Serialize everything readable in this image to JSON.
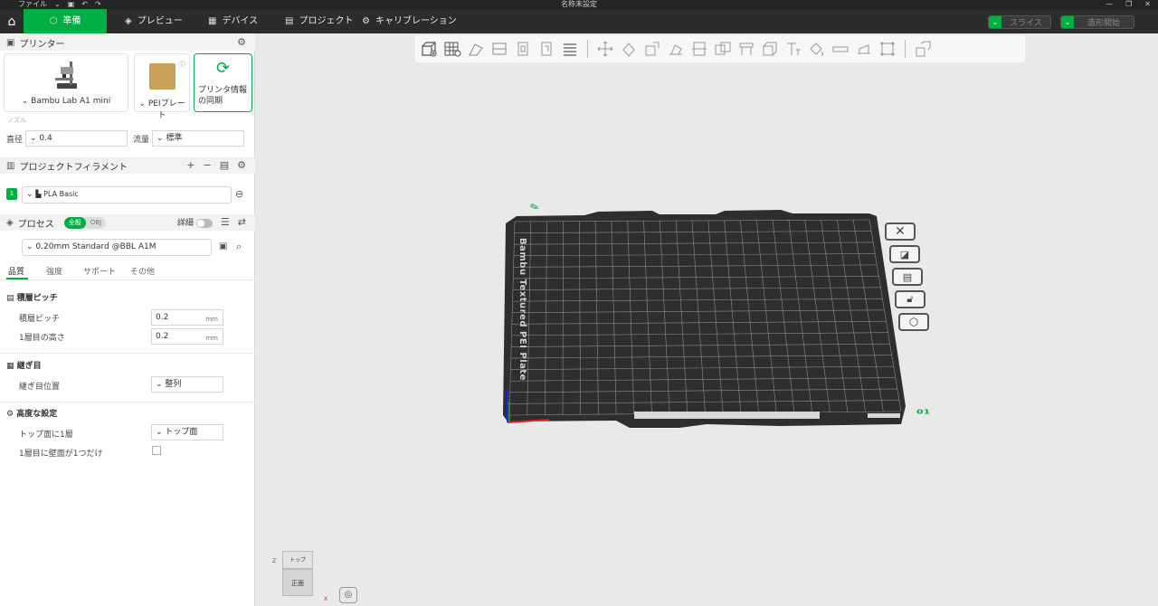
{
  "titlebar": {
    "file_menu": "ファイル",
    "title": "名称未設定"
  },
  "tabs": [
    {
      "label": "準備",
      "icon": "cube-icon"
    },
    {
      "label": "プレビュー",
      "icon": "layers-icon"
    },
    {
      "label": "デバイス",
      "icon": "device-icon"
    },
    {
      "label": "プロジェクト",
      "icon": "project-icon"
    },
    {
      "label": "キャリブレーション",
      "icon": "calibration-icon"
    }
  ],
  "top_buttons": {
    "slice": "スライス",
    "print": "造形開始"
  },
  "printer": {
    "section_title": "プリンター",
    "printer_name": "Bambu Lab A1 mini",
    "plate": "PEIプレート",
    "sync": "プリンタ情報の同期",
    "nozzle_label": "ノズル",
    "diameter_label": "直径",
    "diameter_value": "0.4",
    "flow_label": "流量",
    "flow_value": "標準"
  },
  "filament": {
    "section_title": "プロジェクトフィラメント",
    "items": [
      {
        "index": "1",
        "name": "PLA Basic",
        "color": "#00ae42"
      }
    ]
  },
  "process": {
    "section_title": "プロセス",
    "toggle_global": "全般",
    "toggle_obj": "OBJ",
    "advanced_label": "詳細",
    "preset": "0.20mm Standard @BBL A1M",
    "tabs": [
      "品質",
      "強度",
      "サポート",
      "その他"
    ]
  },
  "quality": {
    "layer_group": "積層ピッチ",
    "layer_height_label": "積層ピッチ",
    "layer_height_value": "0.2",
    "unit": "mm",
    "first_layer_label": "1層目の高さ",
    "first_layer_value": "0.2",
    "seam_group": "継ぎ目",
    "seam_label": "継ぎ目位置",
    "seam_value": "整列",
    "adv_group": "高度な設定",
    "top_one_label": "トップ面に1層",
    "top_one_value": "トップ面",
    "first_wall_label": "1層目に壁面が1つだけ"
  },
  "plate": {
    "label": "Bambu Textured PEI Plate",
    "number": "01"
  },
  "viewcube": {
    "top": "トップ",
    "front": "正面",
    "z": "Z",
    "x": "X"
  },
  "accent": "#00ae42"
}
